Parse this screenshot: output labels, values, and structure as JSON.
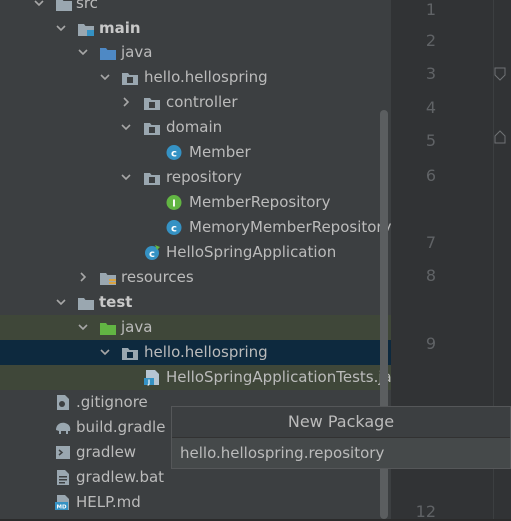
{
  "tree": {
    "src": "src",
    "main": "main",
    "main_java": "java",
    "main_pkg": "hello.hellospring",
    "controller": "controller",
    "domain": "domain",
    "member": "Member",
    "repository": "repository",
    "member_repository": "MemberRepository",
    "memory_member_repository": "MemoryMemberRepository",
    "hello_spring_application": "HelloSpringApplication",
    "resources": "resources",
    "test": "test",
    "test_java": "java",
    "test_pkg": "hello.hellospring",
    "hello_spring_application_tests": "HelloSpringApplicationTests.ja",
    "gitignore": ".gitignore",
    "build_gradle": "build.gradle",
    "gradlew": "gradlew",
    "gradlew_bat": "gradlew.bat",
    "help_md": "HELP.md"
  },
  "gutter": {
    "line_numbers": [
      "1",
      "2",
      "3",
      "4",
      "5",
      "6",
      "7",
      "8",
      "9",
      "12"
    ]
  },
  "popup": {
    "title": "New Package",
    "input_value": "hello.hellospring.repository"
  },
  "colors": {
    "class_icon": "#3592c4",
    "interface_icon": "#62b543",
    "folder_blue": "#4e89c5",
    "folder_green": "#62b543",
    "folder_gray": "#9aa7b0"
  }
}
